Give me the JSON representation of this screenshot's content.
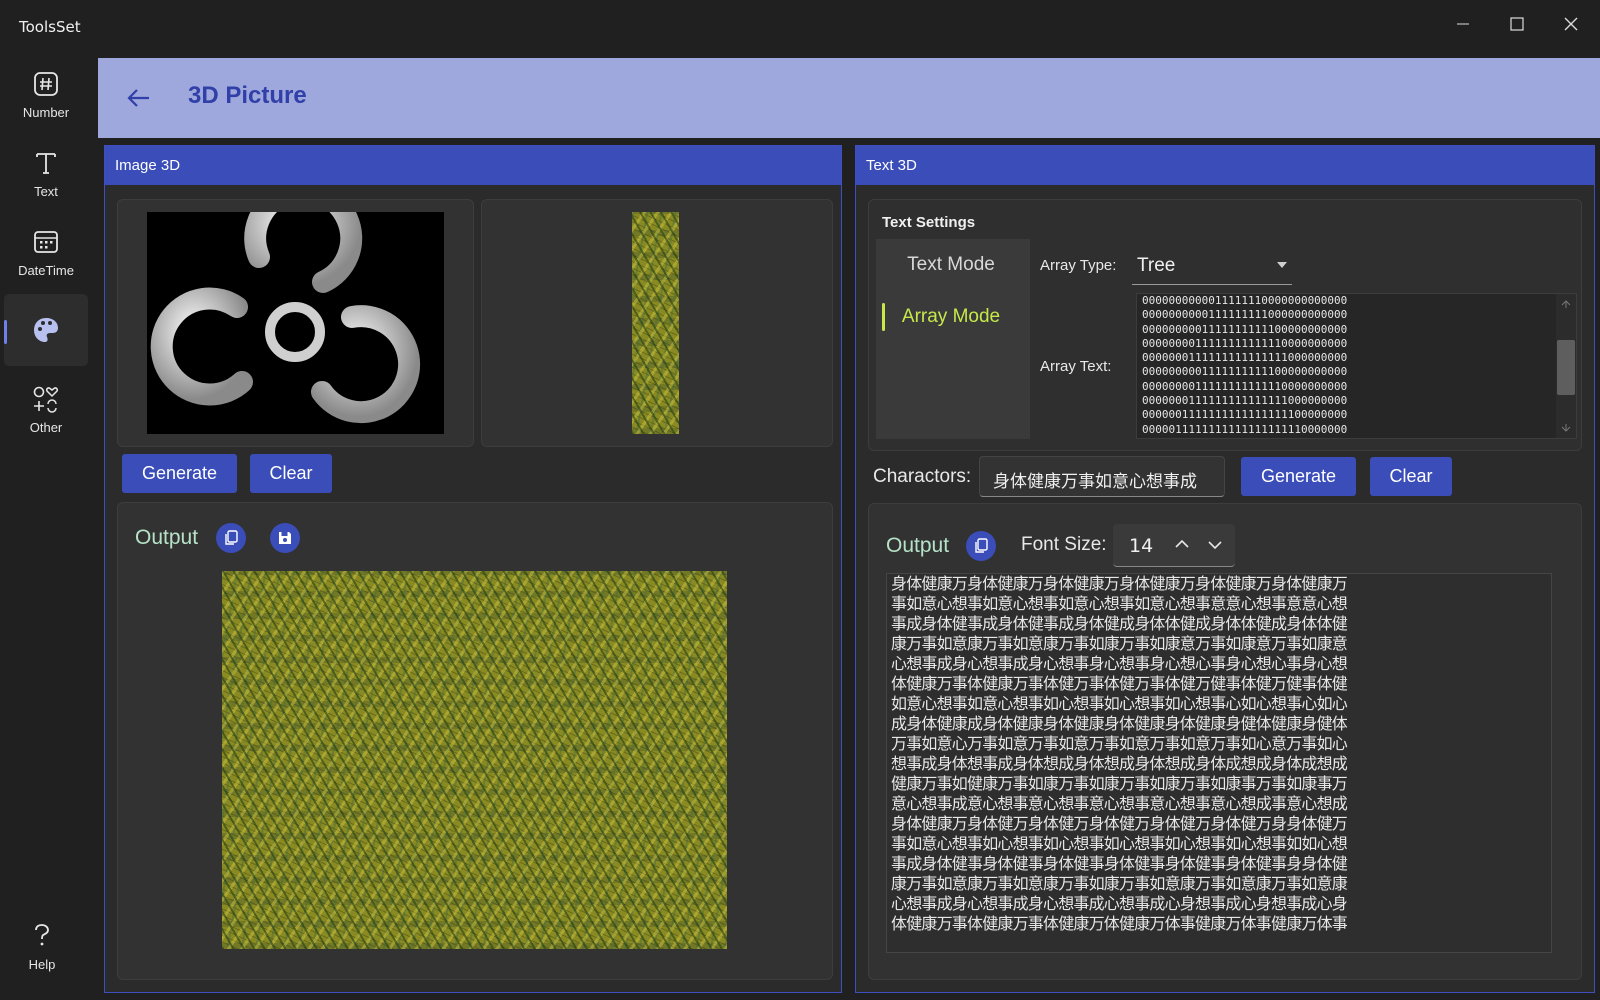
{
  "app": {
    "title": "ToolsSet"
  },
  "window_controls": {
    "minimize": "minimize-icon",
    "maximize": "maximize-icon",
    "close": "close-icon"
  },
  "nav": {
    "items": [
      {
        "label": "Number",
        "icon": "hash-icon"
      },
      {
        "label": "Text",
        "icon": "text-icon"
      },
      {
        "label": "DateTime",
        "icon": "calendar-icon"
      },
      {
        "label": "",
        "icon": "palette-icon",
        "active": true
      },
      {
        "label": "Other",
        "icon": "shapes-icon"
      }
    ],
    "help": {
      "label": "Help",
      "icon": "question-icon"
    }
  },
  "header": {
    "title": "3D Picture",
    "back_icon": "back-arrow-icon"
  },
  "image3d": {
    "title": "Image 3D",
    "generate_label": "Generate",
    "clear_label": "Clear",
    "output_label": "Output",
    "copy_icon": "copy-icon",
    "save_icon": "save-icon"
  },
  "text3d": {
    "title": "Text 3D",
    "settings_title": "Text Settings",
    "tabs": [
      {
        "label": "Text Mode"
      },
      {
        "label": "Array Mode",
        "active": true
      }
    ],
    "array_type_label": "Array Type:",
    "array_type_value": "Tree",
    "array_text_label": "Array Text:",
    "array_lines": [
      "0000000000011111110000000000000",
      "0000000000111111111000000000000",
      "0000000001111111111100000000000",
      "0000000011111111111110000000000",
      "0000000111111111111111000000000",
      "0000000001111111111100000000000",
      "0000000011111111111110000000000",
      "0000000111111111111111000000000",
      "0000001111111111111111100000000",
      "0000011111111111111111110000000"
    ],
    "characters_label": "Charactors:",
    "characters_value": "身体健康万事如意心想事成",
    "generate_label": "Generate",
    "clear_label": "Clear",
    "output_label": "Output",
    "font_size_label": "Font Size:",
    "font_size_value": "14",
    "output_lines": [
      "身体健康万身体健康万身体健康万身体健康万身体健康万身体健康万",
      "事如意心想事如意心想事如意心想事如意心想事意意心想事意意心想",
      "事成身体健事成身体健事成身体健成身体体健成身体体健成身体体健",
      "康万事如意康万事如意康万事如康万事如康意万事如康意万事如康意",
      "心想事成身心想事成身心想事身心想事身心想心事身心想心事身心想",
      "体健康万事体健康万事体健万事体健万事体健万健事体健万健事体健",
      "如意心想事如意心想事如心想事如心想事如心想事心如心想事心如心",
      "成身体健康成身体健康身体健康身体健康身体健康身健体健康身健体",
      "万事如意心万事如意万事如意万事如意万事如意万事如心意万事如心",
      "想事成身体想事成身体想成身体想成身体想成身体成想成身体成想成",
      "健康万事如健康万事如康万事如康万事如康万事如康事万事如康事万",
      "意心想事成意心想事意心想事意心想事意心想事意心想成事意心想成",
      "身体健康万身体健万身体健万身体健万身体健万身体健万身身体健万",
      "事如意心想事如心想事如心想事如心想事如心想事如心想事如如心想",
      "事成身体健事身体健事身体健事身体健事身体健事身体健事身身体健",
      "康万事如意康万事如意康万事如康万事如意康万事如意康万事如意康",
      "心想事成身心想事成身心想事成心想事成心身想事成心身想事成心身",
      "体健康万事体健康万事体健康万体健康万体事健康万体事健康万体事"
    ]
  }
}
